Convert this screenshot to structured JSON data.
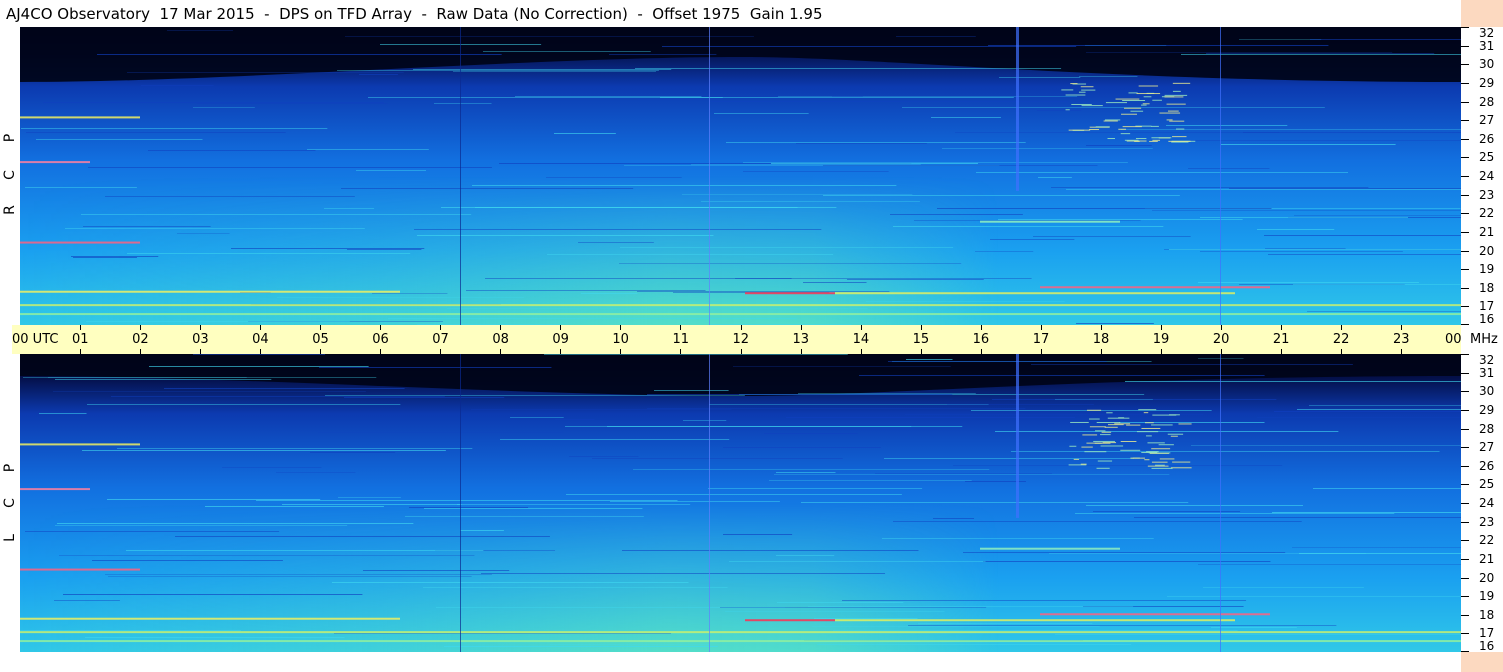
{
  "title": "AJ4CO Observatory  17 Mar 2015  -  DPS on TFD Array  -  Raw Data (No Correction)  -  Offset 1975  Gain 1.95",
  "panels": {
    "top": {
      "letters": [
        "R",
        "C",
        "P"
      ]
    },
    "bottom": {
      "letters": [
        "L",
        "C",
        "P"
      ]
    }
  },
  "time_axis": {
    "first_label": "00  UTC",
    "labels": [
      "01",
      "02",
      "03",
      "04",
      "05",
      "06",
      "07",
      "08",
      "09",
      "10",
      "11",
      "12",
      "13",
      "14",
      "15",
      "16",
      "17",
      "18",
      "19",
      "20",
      "21",
      "22",
      "23"
    ],
    "last_label": "00",
    "unit_label": "MHz"
  },
  "freq_axis": {
    "labels": [
      "32",
      "31",
      "30",
      "29",
      "28",
      "27",
      "26",
      "25",
      "24",
      "23",
      "22",
      "21",
      "20",
      "19",
      "18",
      "17",
      "16"
    ]
  },
  "colors": {
    "background_dark": "#000820",
    "deep_blue": "#0a1a80",
    "mid_blue": "#1060e0",
    "cyan": "#20b0f0",
    "green": "#40e0a0",
    "yellow": "#e0f060",
    "red": "#ff2040",
    "utc_bar": "#ffffc0",
    "side_strip": "#fcd9c0"
  }
}
